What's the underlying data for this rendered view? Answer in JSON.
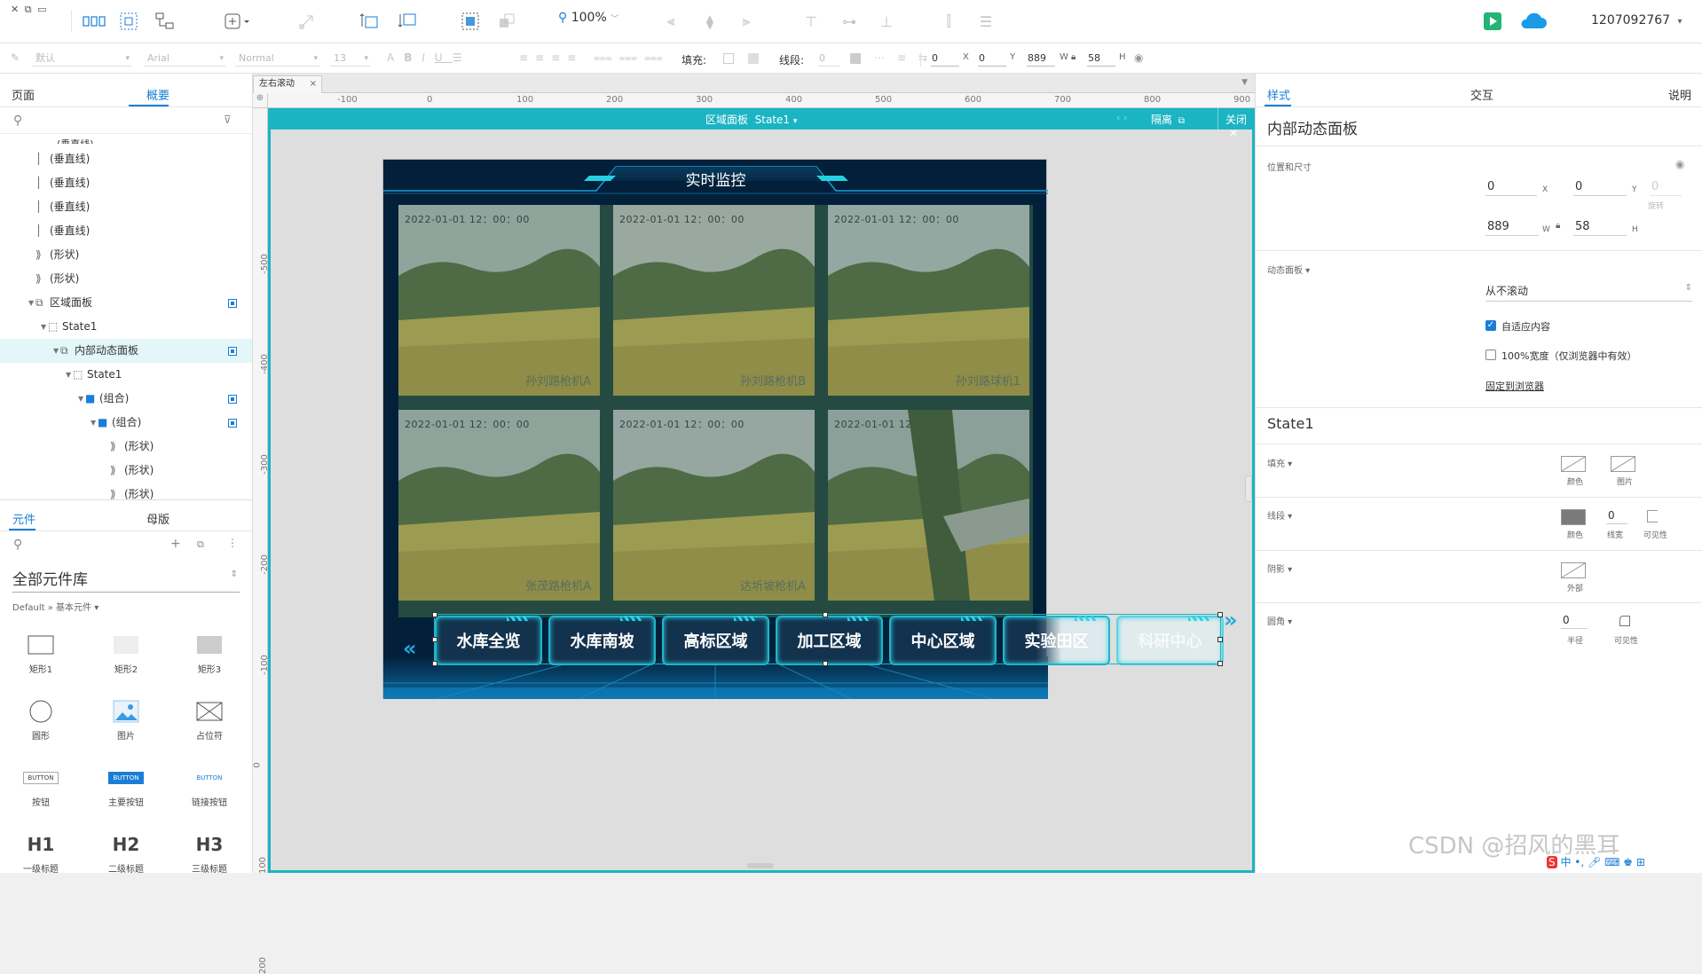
{
  "topbar": {
    "zoom": "100%",
    "user": "1207092767",
    "icons": [
      "close-icon",
      "copy-icon",
      "paste-icon",
      "select-mode-icon",
      "contain-select-icon",
      "connect-icon",
      "insert-icon",
      "point-icon",
      "front-icon",
      "back-icon",
      "group-icon",
      "ungroup-icon",
      "zoom-icon",
      "align-left-icon",
      "align-center-icon",
      "align-right-icon",
      "align-top-icon",
      "align-middle-icon",
      "align-bottom-icon",
      "distribute-h-icon",
      "distribute-v-icon",
      "preview-icon",
      "publish-cloud-icon"
    ]
  },
  "format": {
    "style": "默认",
    "font": "Arial",
    "weight": "Normal",
    "size": "13",
    "fill_label": "填充:",
    "stroke_label": "线段:",
    "stroke_val": "0",
    "x": "0",
    "y": "0",
    "w": "889",
    "h": "58",
    "x_lbl": "X",
    "y_lbl": "Y",
    "w_lbl": "W",
    "h_lbl": "H"
  },
  "left": {
    "tabs": [
      "页面",
      "概要"
    ],
    "tree": [
      {
        "label": "(垂直线)",
        "indent": 50,
        "icon": "line"
      },
      {
        "label": "(垂直线)",
        "indent": 50,
        "icon": "line"
      },
      {
        "label": "(垂直线)",
        "indent": 50,
        "icon": "line"
      },
      {
        "label": "(垂直线)",
        "indent": 50,
        "icon": "line"
      },
      {
        "label": "(形状)",
        "indent": 50,
        "icon": "shape"
      },
      {
        "label": "(形状)",
        "indent": 50,
        "icon": "shape"
      },
      {
        "label": "区域面板",
        "indent": 50,
        "icon": "panel"
      },
      {
        "label": "State1",
        "indent": 64,
        "icon": "state"
      },
      {
        "label": "内部动态面板",
        "indent": 78,
        "icon": "panel"
      },
      {
        "label": "State1",
        "indent": 92,
        "icon": "state"
      },
      {
        "label": "(组合)",
        "indent": 106,
        "icon": "folder"
      },
      {
        "label": "(组合)",
        "indent": 120,
        "icon": "folder"
      },
      {
        "label": "(形状)",
        "indent": 134,
        "icon": "shape"
      },
      {
        "label": "(形状)",
        "indent": 134,
        "icon": "shape"
      },
      {
        "label": "(形状)",
        "indent": 134,
        "icon": "shape"
      }
    ],
    "lib_tabs": [
      "元件",
      "母版"
    ],
    "lib_title": "全部元件库",
    "lib_crumb": "Default » 基本元件 ▾",
    "lib_items": [
      "矩形1",
      "矩形2",
      "矩形3",
      "圆形",
      "图片",
      "占位符",
      "按钮",
      "主要按钮",
      "链接按钮",
      "一级标题",
      "二级标题",
      "三级标题"
    ],
    "button_texts": [
      "BUTTON",
      "BUTTON",
      "BUTTON"
    ],
    "heading_texts": [
      "H1",
      "H2",
      "H3"
    ]
  },
  "canvas": {
    "doc_tab": "左右滚动",
    "ruler_h": [
      "-100",
      "0",
      "100",
      "200",
      "300",
      "400",
      "500",
      "600",
      "700",
      "800",
      "900"
    ],
    "ruler_v": [
      "-500",
      "-400",
      "-300",
      "-200",
      "-100",
      "0",
      "100",
      "200"
    ],
    "frame_title": "区域面板",
    "frame_state": "State1",
    "isolate": "隔离",
    "close": "关闭"
  },
  "monitor": {
    "title": "实时监控",
    "tiles": [
      {
        "ts": "2022-01-01  12：00：00",
        "cam": "孙刘路枪机A"
      },
      {
        "ts": "2022-01-01  12：00：00",
        "cam": "孙刘路枪机B"
      },
      {
        "ts": "2022-01-01  12：00：00",
        "cam": "孙刘路球机1"
      },
      {
        "ts": "2022-01-01  12：00：00",
        "cam": "张茂路枪机A"
      },
      {
        "ts": "2022-01-01  12：00：00",
        "cam": "达圻坡枪机A"
      },
      {
        "ts": "2022-01-01  12：",
        "cam": ""
      }
    ],
    "nav": [
      "水库全览",
      "水库南坡",
      "高标区域",
      "加工区域",
      "中心区域",
      "实验田区",
      "科研中心"
    ]
  },
  "right": {
    "tabs": [
      "样式",
      "交互",
      "说明"
    ],
    "title": "内部动态面板",
    "pos_label": "位置和尺寸",
    "x": "0",
    "y": "0",
    "w": "889",
    "h": "58",
    "rot": "0",
    "x_lbl": "X",
    "y_lbl": "Y",
    "w_lbl": "W",
    "h_lbl": "H",
    "rot_lbl": "旋转",
    "dp_label": "动态面板",
    "scroll": "从不滚动",
    "fit": "自适应内容",
    "fullwidth": "100%宽度（仅浏览器中有效）",
    "pin": "固定到浏览器",
    "state_title": "State1",
    "fill_label": "填充",
    "fill_color": "颜色",
    "fill_image": "图片",
    "stroke_label": "线段",
    "stroke_color": "颜色",
    "stroke_width_val": "0",
    "stroke_width": "线宽",
    "stroke_vis": "可见性",
    "shadow_label": "阴影",
    "shadow_outer": "外部",
    "radius_label": "圆角",
    "radius_val": "0",
    "radius": "半径",
    "radius_vis": "可见性"
  },
  "watermark": "CSDN @招风的黑耳",
  "colors": {
    "accent": "#1a7ed6",
    "frame": "#1bb4c3",
    "panel_bg": "#03203a",
    "nav_border": "#1fb5c9"
  }
}
